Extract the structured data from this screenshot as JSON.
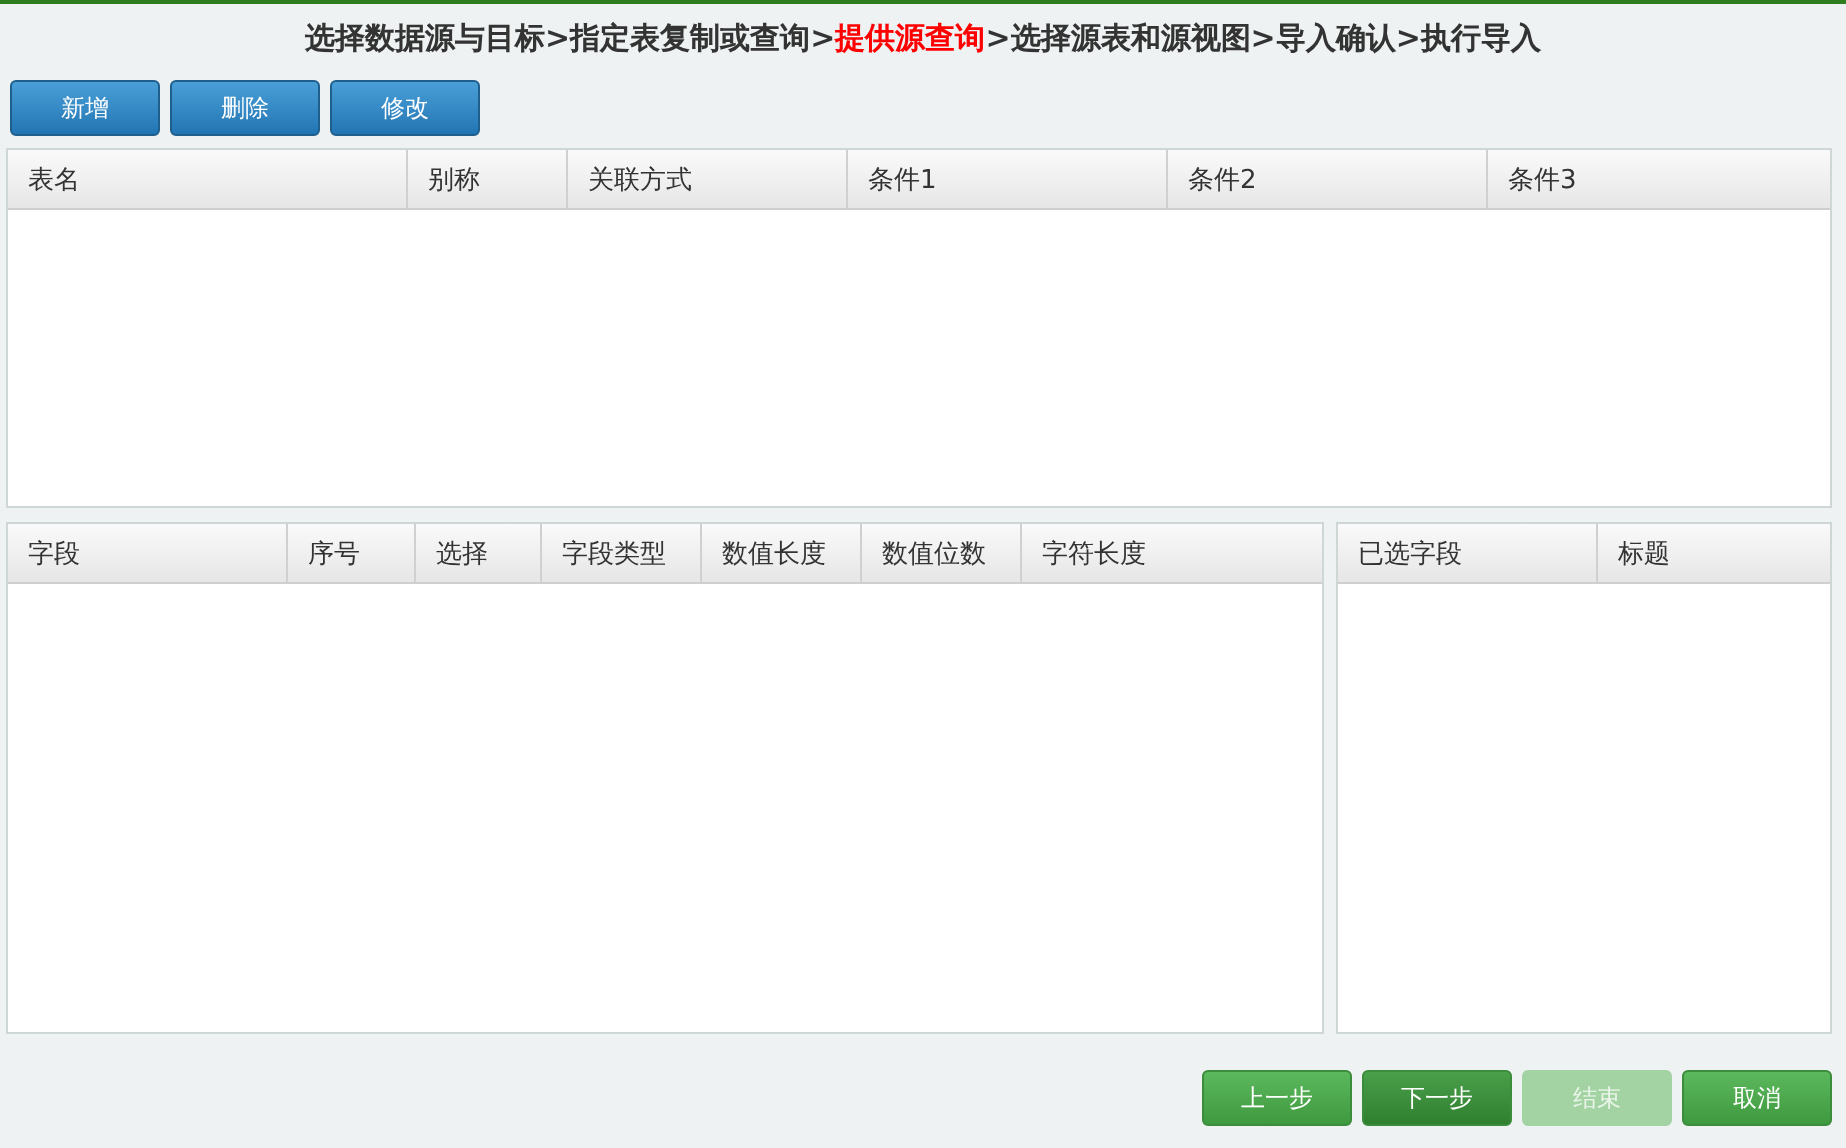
{
  "breadcrumb": [
    {
      "kind": "step",
      "label": "选择数据源与目标",
      "selected": false
    },
    {
      "kind": "separator",
      "label": ">"
    },
    {
      "kind": "step",
      "label": "指定表复制或查询",
      "selected": false
    },
    {
      "kind": "separator",
      "label": ">"
    },
    {
      "kind": "step",
      "label": "提供源查询",
      "selected": true
    },
    {
      "kind": "separator",
      "label": ">"
    },
    {
      "kind": "step",
      "label": "选择源表和源视图",
      "selected": false
    },
    {
      "kind": "separator",
      "label": ">"
    },
    {
      "kind": "step",
      "label": "导入确认",
      "selected": false
    },
    {
      "kind": "separator",
      "label": ">"
    },
    {
      "kind": "step",
      "label": "执行导入",
      "selected": false
    }
  ],
  "toolbar": [
    "新增",
    "删除",
    "修改"
  ],
  "tables_table": {
    "columns": [
      "表名",
      "别称",
      "关联方式",
      "条件1",
      "条件2",
      "条件3"
    ]
  },
  "fields_table": {
    "columns": [
      "字段",
      "序号",
      "选择",
      "字段类型",
      "数值长度",
      "数值位数",
      "字符长度"
    ]
  },
  "selected_fields_table": {
    "columns": [
      "已选字段",
      "标题"
    ]
  },
  "footer_buttons": [
    {
      "label": "上一步",
      "selected": false,
      "disabled": false
    },
    {
      "label": "下一步",
      "selected": true,
      "disabled": false
    },
    {
      "label": "结束",
      "selected": false,
      "disabled": true
    },
    {
      "label": "取消",
      "selected": false,
      "disabled": false
    }
  ]
}
